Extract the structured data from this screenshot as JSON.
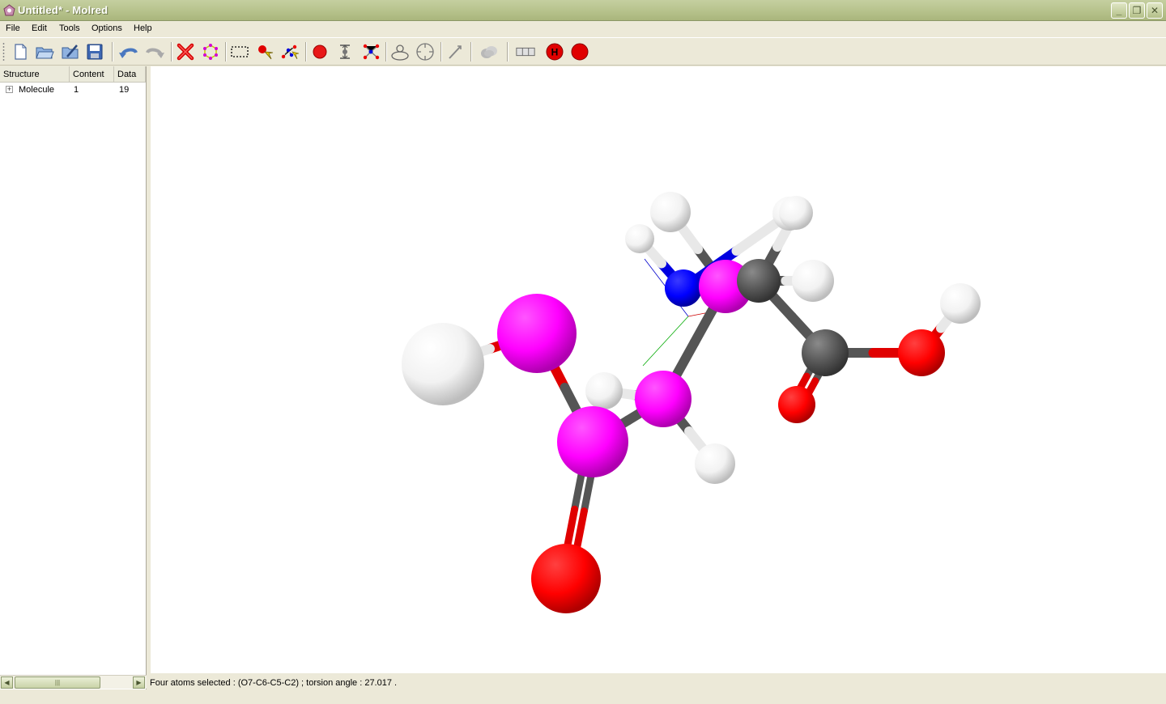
{
  "window": {
    "title": "Untitled* - Molred",
    "minimize_glyph": "_",
    "restore_glyph": "❐",
    "close_glyph": "✕"
  },
  "menu": [
    "File",
    "Edit",
    "Tools",
    "Options",
    "Help"
  ],
  "toolbar": {
    "icons": [
      "new-file-icon",
      "open-folder-icon",
      "save-as-icon",
      "save-icon",
      "undo-icon",
      "redo-icon",
      "delete-icon",
      "select-all-icon",
      "rectangle-select-icon",
      "atom-pick-icon",
      "bond-pick-icon",
      "add-atom-icon",
      "distance-icon",
      "angle-icon",
      "torsion-icon",
      "rotate-icon",
      "attach-icon",
      "electron-cloud-icon",
      "periodic-table-icon",
      "hydrogen-icon",
      "element-color-icon"
    ],
    "hydrogen_label": "H"
  },
  "tree": {
    "headers": [
      "Structure",
      "Content",
      "Data"
    ],
    "rows": [
      {
        "structure": "Molecule",
        "content": "1",
        "data": "19"
      }
    ],
    "scroll_left": "◀",
    "scroll_right": "▶",
    "thumb_grip": "|||"
  },
  "status": {
    "message": "Four atoms selected : (O7-C6-C5-C2) ; torsion angle :  27.017 ."
  },
  "colors": {
    "titlebar": "#b5c18a",
    "carbon": "#555555",
    "oxygen": "#ff0000",
    "nitrogen": "#0000ff",
    "hydrogen": "#ffffff",
    "selected": "#ff00ff"
  },
  "molecule": {
    "atoms": [
      {
        "id": "H1",
        "el": "H"
      },
      {
        "id": "H2",
        "el": "H"
      },
      {
        "id": "H3",
        "el": "H"
      },
      {
        "id": "N1",
        "el": "N"
      },
      {
        "id": "C5",
        "el": "Csel"
      },
      {
        "id": "C3",
        "el": "C"
      },
      {
        "id": "H4",
        "el": "H"
      },
      {
        "id": "H5",
        "el": "H"
      },
      {
        "id": "C4",
        "el": "C"
      },
      {
        "id": "O8",
        "el": "O"
      },
      {
        "id": "O9",
        "el": "O"
      },
      {
        "id": "H6",
        "el": "H"
      },
      {
        "id": "O7",
        "el": "Osel"
      },
      {
        "id": "H7",
        "el": "Hbig"
      },
      {
        "id": "C6",
        "el": "Csel"
      },
      {
        "id": "H8",
        "el": "H"
      },
      {
        "id": "C2",
        "el": "Csel"
      },
      {
        "id": "H9",
        "el": "H"
      },
      {
        "id": "O10",
        "el": "O"
      }
    ],
    "bonds": [
      [
        "C5",
        "N1"
      ],
      [
        "C5",
        "C3"
      ],
      [
        "C5",
        "H1"
      ],
      [
        "C5",
        "C6"
      ],
      [
        "N1",
        "H2"
      ],
      [
        "N1",
        "H3"
      ],
      [
        "C3",
        "H4"
      ],
      [
        "C3",
        "H5"
      ],
      [
        "C3",
        "C4"
      ],
      [
        "C4",
        "O9"
      ],
      [
        "C4",
        "O8"
      ],
      [
        "O9",
        "H6"
      ],
      [
        "O7",
        "H7"
      ],
      [
        "O7",
        "C2"
      ],
      [
        "C6",
        "C2"
      ],
      [
        "C6",
        "H8"
      ],
      [
        "C6",
        "H9"
      ],
      [
        "C2",
        "O10"
      ]
    ]
  }
}
